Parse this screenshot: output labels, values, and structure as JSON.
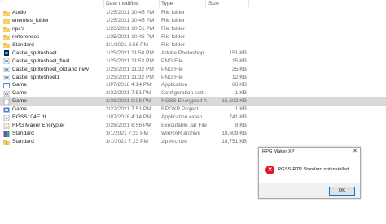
{
  "header": {
    "date_modified": "Date modified",
    "type": "Type",
    "size": "Size"
  },
  "rows": [
    {
      "name": "Audio",
      "date": "1/25/2021 10:45 PM",
      "type": "File folder",
      "size": "",
      "icon": "folder-icon"
    },
    {
      "name": "enemies_folder",
      "date": "1/25/2021 10:45 PM",
      "type": "File folder",
      "size": "",
      "icon": "folder-icon"
    },
    {
      "name": "npc's",
      "date": "1/26/2021 10:51 PM",
      "type": "File folder",
      "size": "",
      "icon": "folder-icon"
    },
    {
      "name": "rerferences",
      "date": "1/25/2021 10:45 PM",
      "type": "File folder",
      "size": "",
      "icon": "folder-icon"
    },
    {
      "name": "Standard",
      "date": "3/1/2021 6:56 PM",
      "type": "File folder",
      "size": "",
      "icon": "folder-icon"
    },
    {
      "name": "Castle_spritesheet",
      "date": "1/25/2021 11:50 PM",
      "type": "Adobe Photoshop...",
      "size": "151 KB",
      "icon": "photoshop-file-icon"
    },
    {
      "name": "Castle_spritesheet_final",
      "date": "1/25/2021 11:53 PM",
      "type": "PNG File",
      "size": "15 KB",
      "icon": "png-file-icon"
    },
    {
      "name": "Castle_spritesheet_old and new",
      "date": "1/25/2021 11:32 PM",
      "type": "PNG File",
      "size": "25 KB",
      "icon": "png-file-icon"
    },
    {
      "name": "Castle_spritesheet1",
      "date": "1/25/2021 11:32 PM",
      "type": "PNG File",
      "size": "12 KB",
      "icon": "png-file-icon"
    },
    {
      "name": "Game",
      "date": "10/7/2018 4:14 PM",
      "type": "Application",
      "size": "66 KB",
      "icon": "application-icon"
    },
    {
      "name": "Game",
      "date": "2/22/2021 7:51 PM",
      "type": "Configuration sett...",
      "size": "1 KB",
      "icon": "config-file-icon"
    },
    {
      "name": "Game",
      "date": "2/28/2021 9:08 PM",
      "type": "RGSS Encrypted A...",
      "size": "15,603 KB",
      "icon": "rgss-archive-icon",
      "selected": true
    },
    {
      "name": "Game",
      "date": "2/22/2021 7:51 PM",
      "type": "RPGXP Project",
      "size": "1 KB",
      "icon": "rpgxp-project-icon"
    },
    {
      "name": "RGSS104E.dll",
      "date": "10/7/2018 4:14 PM",
      "type": "Application exten...",
      "size": "741 KB",
      "icon": "dll-file-icon"
    },
    {
      "name": "RPG Maker Encrypter",
      "date": "2/28/2021 8:56 PM",
      "type": "Executable Jar File",
      "size": "8 KB",
      "icon": "jar-file-icon"
    },
    {
      "name": "Standard",
      "date": "3/1/2021 7:23 PM",
      "type": "WinRAR archive",
      "size": "18,609 KB",
      "icon": "winrar-archive-icon"
    },
    {
      "name": "Standard",
      "date": "3/1/2021 7:23 PM",
      "type": "zip Archive",
      "size": "18,751 KB",
      "icon": "zip-archive-icon"
    }
  ],
  "dialog": {
    "title": "RPG Maker XP",
    "message": "RGSS-RTP Standard not installed.",
    "ok_label": "OK",
    "close_glyph": "✕",
    "icon": "error-icon"
  },
  "colors": {
    "folder": "#e8b94a",
    "error": "#e81123",
    "selection": "#d9d9d9",
    "button_border": "#0078d7"
  }
}
